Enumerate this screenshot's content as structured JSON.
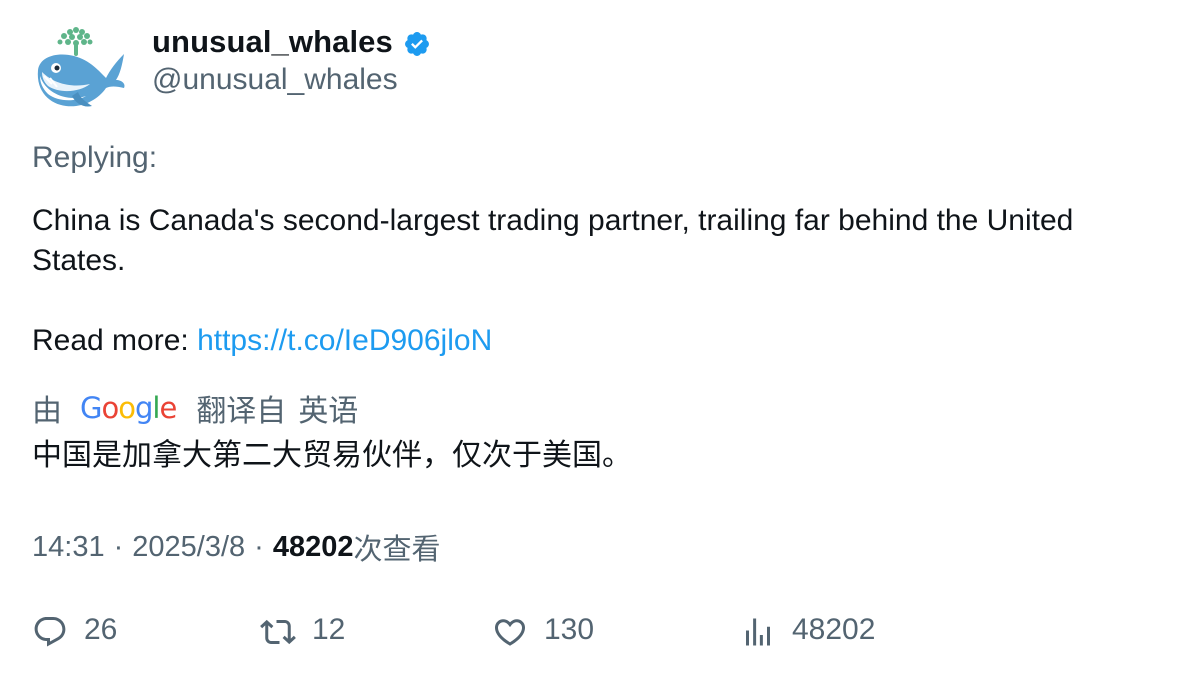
{
  "author": {
    "display_name": "unusual_whales",
    "handle": "@unusual_whales",
    "verified": true,
    "avatar_icon": "whale-avatar"
  },
  "tweet": {
    "replying_label": "Replying:",
    "text": "China is Canada's second-largest trading partner, trailing far behind the United States.",
    "read_more_label": "Read more: ",
    "link": "https://t.co/IeD906jloN"
  },
  "translation": {
    "prefix": "由",
    "provider": "Google",
    "suffix": "翻译自",
    "source_language": "英语",
    "translated_text": "中国是加拿大第二大贸易伙伴，仅次于美国。"
  },
  "meta": {
    "time": "14:31",
    "separator": "·",
    "date": "2025/3/8",
    "views_count": "48202",
    "views_label": "次查看"
  },
  "actions": {
    "replies": "26",
    "retweets": "12",
    "likes": "130",
    "views": "48202"
  },
  "colors": {
    "text": "#0f1419",
    "secondary": "#536471",
    "link": "#1d9bf0",
    "verified": "#1d9bf0"
  }
}
